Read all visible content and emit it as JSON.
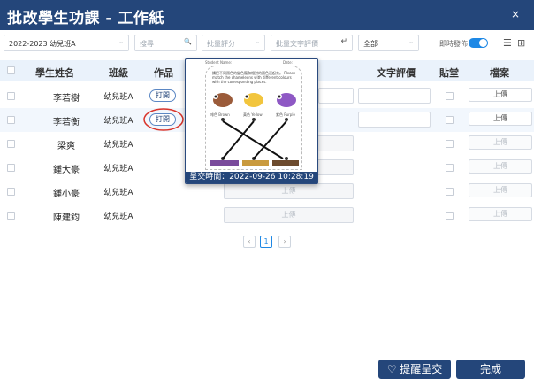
{
  "window": {
    "title": "批改學生功課 - 工作紙",
    "close_glyph": "×"
  },
  "filters": {
    "class_select": "2022-2023 幼兒班A",
    "search_placeholder": "搜尋",
    "batch_score_placeholder": "批量評分",
    "batch_comment_placeholder": "批量文字評價",
    "status_select": "全部",
    "realtime_label": "即時發佈",
    "realtime_on": true
  },
  "table": {
    "headers": [
      "學生姓名",
      "班級",
      "作品",
      "文字評價",
      "貼堂",
      "檔案"
    ],
    "rows": [
      {
        "name": "李若樹",
        "class": "幼兒班A",
        "has_work": true,
        "open_label": "打開",
        "upload_label": "上傳",
        "upload_enabled": true
      },
      {
        "name": "李若衡",
        "class": "幼兒班A",
        "has_work": true,
        "open_label": "打開",
        "upload_label": "上傳",
        "upload_enabled": true
      },
      {
        "name": "梁爽",
        "class": "幼兒班A",
        "has_work": false,
        "upload_label": "上傳",
        "upload_enabled": false
      },
      {
        "name": "鍾大豪",
        "class": "幼兒班A",
        "has_work": false,
        "upload_label": "上傳",
        "upload_enabled": false
      },
      {
        "name": "鍾小豪",
        "class": "幼兒班A",
        "has_work": false,
        "upload_label": "上傳",
        "upload_enabled": false
      },
      {
        "name": "陳建鈞",
        "class": "幼兒班A",
        "has_work": false,
        "upload_label": "上傳",
        "upload_enabled": false
      }
    ]
  },
  "pagination": {
    "current": "1",
    "prev": "‹",
    "next": "›"
  },
  "preview": {
    "header_left": "Student Name:",
    "header_right": "Date:",
    "instruction": "請把不同顏色的變色龍和相對的顏色連起來。 Please match the chameleons with different colours with the corresponding places.",
    "labels": [
      "啡色 Brown",
      "黃色 Yellow",
      "紫色 Purple"
    ],
    "submitted_at": "呈交時間：2022-09-26 10:28:19"
  },
  "footer": {
    "remind_label": "提醒呈交",
    "done_label": "完成"
  },
  "colors": {
    "primary": "#24467a",
    "accent": "#1e88e5",
    "header_bg": "#eaf2fb",
    "highlight": "#d9342b"
  }
}
